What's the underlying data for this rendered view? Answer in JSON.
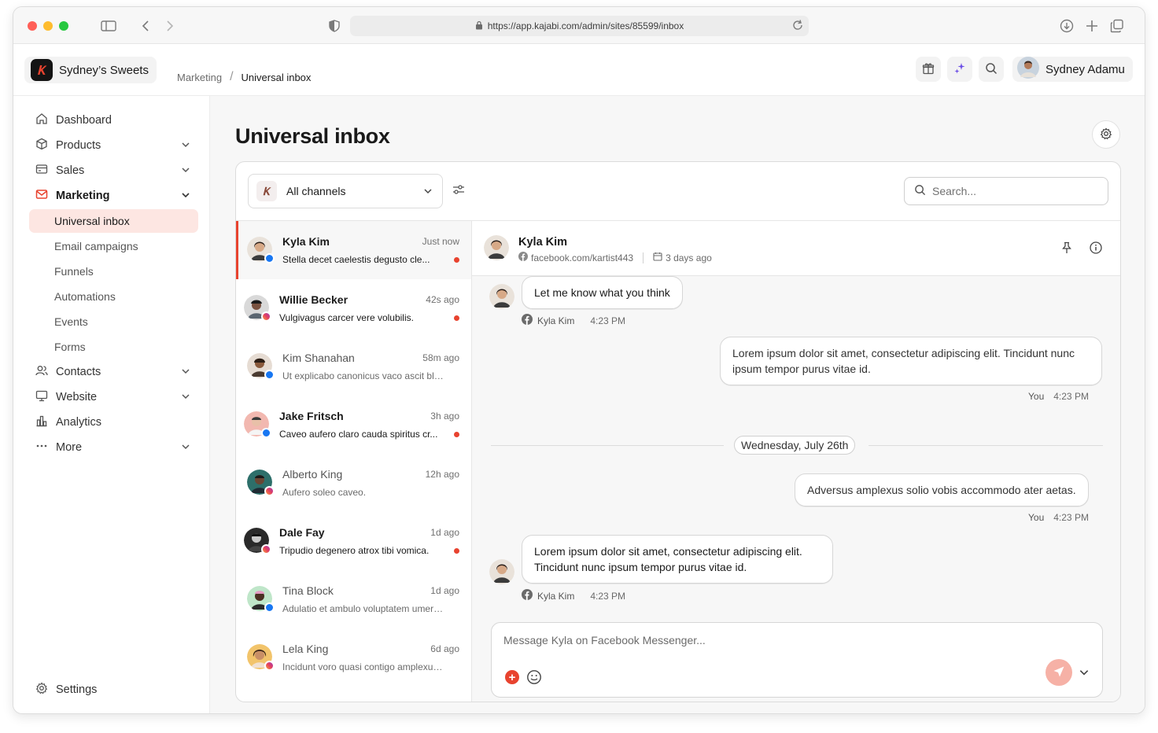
{
  "browser": {
    "url": "https://app.kajabi.com/admin/sites/85599/inbox"
  },
  "header": {
    "site_name": "Sydney’s Sweets",
    "breadcrumb": [
      "Marketing",
      "Universal inbox"
    ],
    "user_name": "Sydney Adamu"
  },
  "sidebar": {
    "items": [
      {
        "label": "Dashboard",
        "icon": "home-icon",
        "has_chevron": false
      },
      {
        "label": "Products",
        "icon": "box-icon",
        "has_chevron": true
      },
      {
        "label": "Sales",
        "icon": "credit-card-icon",
        "has_chevron": true
      },
      {
        "label": "Marketing",
        "icon": "mail-icon",
        "has_chevron": true,
        "active": true
      },
      {
        "label": "Contacts",
        "icon": "users-icon",
        "has_chevron": true
      },
      {
        "label": "Website",
        "icon": "monitor-icon",
        "has_chevron": true
      },
      {
        "label": "Analytics",
        "icon": "bar-chart-icon",
        "has_chevron": false
      },
      {
        "label": "More",
        "icon": "more-dots-icon",
        "has_chevron": true
      }
    ],
    "marketing_sub": [
      "Universal inbox",
      "Email campaigns",
      "Funnels",
      "Automations",
      "Events",
      "Forms"
    ],
    "settings_label": "Settings"
  },
  "main": {
    "title": "Universal inbox",
    "channel_filter": "All channels",
    "search_placeholder": "Search..."
  },
  "conversations": [
    {
      "name": "Kyla Kim",
      "time": "Just now",
      "preview": "Stella decet caelestis degusto cle...",
      "channel": "facebook",
      "unread": true,
      "selected": true
    },
    {
      "name": "Willie Becker",
      "time": "42s ago",
      "preview": "Vulgivagus carcer vere volubilis.",
      "channel": "instagram",
      "unread": true
    },
    {
      "name": "Kim Shanahan",
      "time": "58m ago",
      "preview": "Ut explicabo canonicus vaco ascit bla...",
      "channel": "facebook",
      "unread": false
    },
    {
      "name": "Jake Fritsch",
      "time": "3h ago",
      "preview": "Caveo aufero claro cauda spiritus cr...",
      "channel": "facebook",
      "unread": true
    },
    {
      "name": "Alberto King",
      "time": "12h ago",
      "preview": "Aufero soleo caveo.",
      "channel": "instagram",
      "unread": false
    },
    {
      "name": "Dale Fay",
      "time": "1d ago",
      "preview": "Tripudio degenero atrox tibi vomica.",
      "channel": "instagram",
      "unread": true
    },
    {
      "name": "Tina Block",
      "time": "1d ago",
      "preview": "Adulatio et ambulo voluptatem umeru...",
      "channel": "facebook",
      "unread": false
    },
    {
      "name": "Lela King",
      "time": "6d ago",
      "preview": "Incidunt voro quasi contigo amplexus...",
      "channel": "instagram",
      "unread": false
    }
  ],
  "thread": {
    "name": "Kyla Kim",
    "profile": "facebook.com/kartist443",
    "first_seen": "3 days ago",
    "messages": [
      {
        "text": "Let me know what you think",
        "sender": "Kyla Kim",
        "time": "4:23 PM",
        "direction": "in"
      },
      {
        "text": "Lorem ipsum dolor sit amet, consectetur adipiscing elit. Tincidunt nunc ipsum tempor purus vitae id.",
        "sender": "You",
        "time": "4:23 PM",
        "direction": "out"
      },
      {
        "text": "Adversus amplexus solio vobis accommodo ater aetas.",
        "sender": "You",
        "time": "4:23 PM",
        "direction": "out"
      },
      {
        "text": "Lorem ipsum dolor sit amet, consectetur adipiscing elit. Tincidunt nunc ipsum tempor purus vitae id.",
        "sender": "Kyla Kim",
        "time": "4:23 PM",
        "direction": "in"
      }
    ],
    "day_divider": "Wednesday, July 26th",
    "composer_placeholder": "Message Kyla on Facebook Messenger..."
  },
  "colors": {
    "accent": "#e8432f",
    "selected_bg": "#fde6e2",
    "facebook": "#1877f2",
    "send_button": "#f6b1a6"
  }
}
